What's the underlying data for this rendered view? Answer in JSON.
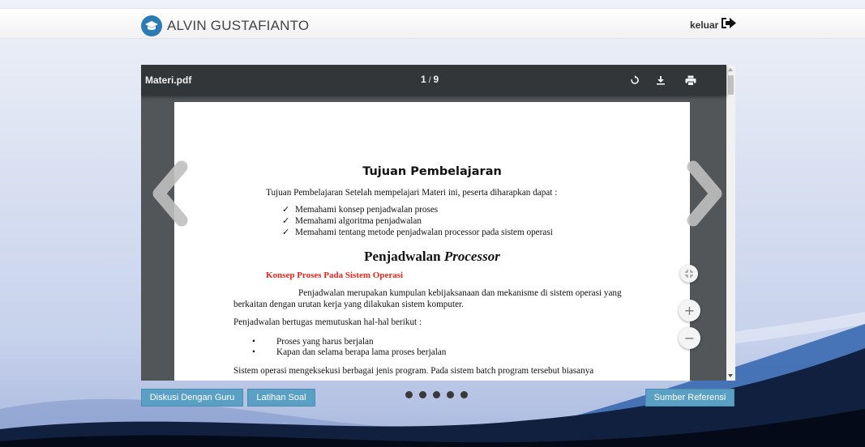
{
  "header": {
    "user_name": "ALVIN GUSTAFIANTO",
    "logout_label": "keluar"
  },
  "viewer": {
    "file_name": "Materi.pdf",
    "current_page": "1",
    "page_separator": "/",
    "total_pages": "9",
    "tools": [
      "rotate-icon",
      "download-icon",
      "print-icon"
    ]
  },
  "document": {
    "title": "Tujuan Pembelajaran",
    "intro": "Tujuan Pembelajaran Setelah mempelajari Materi ini, peserta  diharapkan dapat :",
    "checkmark": "✓",
    "objectives": [
      "Memahami konsep penjadwalan proses",
      "Memahami algoritma penjadwalan",
      "Memahami tentang metode penjadwalan processor pada sistem operasi"
    ],
    "section_title_plain": "Penjadwalan ",
    "section_title_italic": "Processor",
    "subsection_title": "Konsep Proses Pada Sistem Operasi",
    "para1_line1": "Penjadwalan merupakan kumpulan kebijaksanaan dan mekanisme di sistem operasi yang",
    "para1_line2": "berkaitan dengan urutan kerja yang dilakukan sistem komputer.",
    "para2": "Penjadwalan bertugas memutuskan hal-hal berikut :",
    "bullet_char": "•",
    "tasks": [
      "Proses yang harus berjalan",
      "Kapan dan selama berapa lama proses berjalan"
    ],
    "para3": "Sistem operasi mengeksekusi berbagai jenis program. Pada sistem batch program tersebut biasanya"
  },
  "zoom": {
    "fit_icon": "fit-page-icon",
    "zoom_in_label": "+",
    "zoom_out_label": "−"
  },
  "buttons": {
    "discuss": "Diskusi Dengan Guru",
    "exercise": "Latihan Soal",
    "reference": "Sumber Referensi"
  },
  "carousel": {
    "slide_count": 5,
    "active_index": 0
  },
  "colors": {
    "brand_blue": "#2b7cb5",
    "button_blue": "#5a9fc4",
    "subsection_red": "#e8241a",
    "viewer_toolbar": "#323639",
    "viewer_bg": "#525659"
  }
}
